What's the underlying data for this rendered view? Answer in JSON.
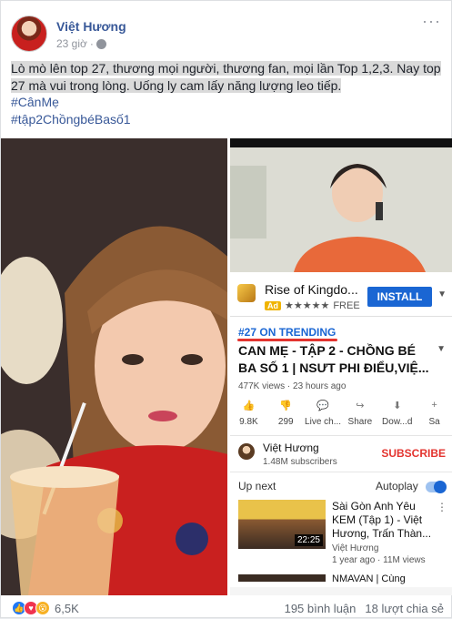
{
  "post": {
    "author": "Việt Hương",
    "time": "23 giờ",
    "caption_line1": "Lò mò lên top 27, thương mọi người, thương fan, mọi lần Top 1,2,3. Nay top 27 mà vui trong lòng. Uống ly cam lấy năng lượng leo tiếp.",
    "hashtag1": "#CânMẹ",
    "hashtag2": "#tập2ChồngbéBasố1"
  },
  "youtube": {
    "ad_title": "Rise of Kingdo...",
    "ad_badge": "Ad",
    "ad_stars": "★★★★★",
    "ad_price": "FREE",
    "install_label": "INSTALL",
    "trending_label": "#27 ON TRENDING",
    "video_title": "CAN MẸ - TẬP 2 - CHỒNG BÉ BA SỐ 1 | NSƯT PHI ĐIỂU,VIỆ...",
    "views": "477K views · 23 hours ago",
    "actions": [
      {
        "icon": "👍",
        "label": "9.8K"
      },
      {
        "icon": "👎",
        "label": "299"
      },
      {
        "icon": "💬",
        "label": "Live ch..."
      },
      {
        "icon": "↪",
        "label": "Share"
      },
      {
        "icon": "⬇",
        "label": "Dow...d"
      },
      {
        "icon": "+",
        "label": "Sa"
      }
    ],
    "channel_name": "Việt Hương",
    "channel_subs": "1.48M subscribers",
    "subscribe_label": "SUBSCRIBE",
    "up_next": "Up next",
    "autoplay": "Autoplay",
    "next_title": "Sài Gòn Anh Yêu KEM (Tập 1) - Việt Hương, Trấn Thàn...",
    "next_duration": "22:25",
    "next_channel": "Việt Hương",
    "next_meta": "1 year ago · 11M views",
    "next2_title": "NMAVAN | Cùng"
  },
  "footer": {
    "reaction_count": "6,5K",
    "comments": "195 bình luận",
    "shares": "18 lượt chia sẻ"
  }
}
